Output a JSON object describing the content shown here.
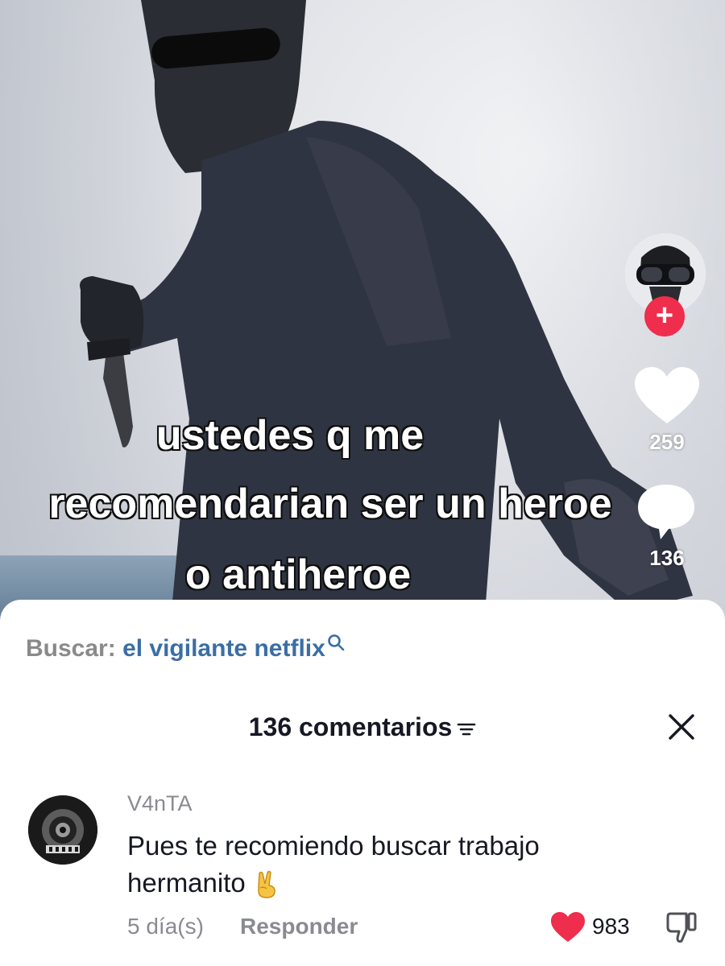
{
  "video": {
    "caption_lines": [
      "ustedes q me",
      "recomendarian ser un heroe",
      "o antiheroe"
    ],
    "likes": "259",
    "comments": "136"
  },
  "search": {
    "label": "Buscar:",
    "term": "el vigilante netflix"
  },
  "comments_header": {
    "title": "136 comentarios"
  },
  "comment": {
    "username": "V4nTA",
    "text": "Pues te recomiendo buscar trabajo hermanito",
    "time": "5 día(s)",
    "reply_label": "Responder",
    "likes": "983"
  },
  "colors": {
    "accent_red": "#ef2d4c",
    "search_blue": "#3a6ea5",
    "muted_gray": "#8a8b91"
  }
}
